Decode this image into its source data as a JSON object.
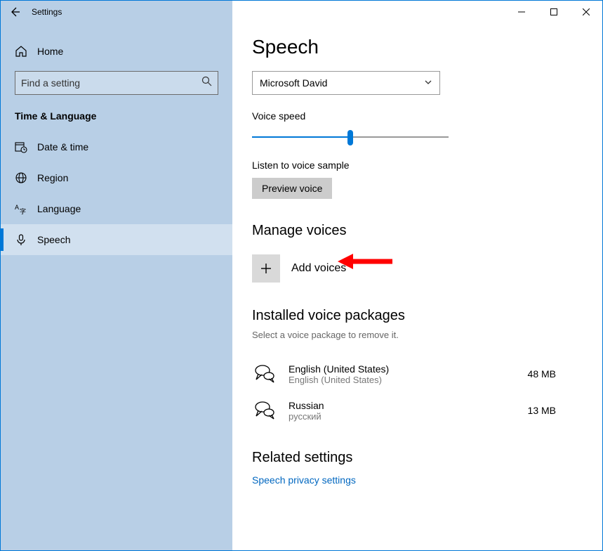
{
  "window": {
    "title": "Settings"
  },
  "sidebar": {
    "home": "Home",
    "search_placeholder": "Find a setting",
    "section": "Time & Language",
    "items": [
      {
        "label": "Date & time"
      },
      {
        "label": "Region"
      },
      {
        "label": "Language"
      },
      {
        "label": "Speech"
      }
    ]
  },
  "page": {
    "title": "Speech",
    "voice_select": "Microsoft David",
    "speed_label": "Voice speed",
    "listen_label": "Listen to voice sample",
    "preview_btn": "Preview voice",
    "manage_header": "Manage voices",
    "add_voices": "Add voices",
    "installed_header": "Installed voice packages",
    "installed_sub": "Select a voice package to remove it.",
    "packages": [
      {
        "name": "English (United States)",
        "sub": "English (United States)",
        "size": "48 MB"
      },
      {
        "name": "Russian",
        "sub": "русский",
        "size": "13 MB"
      }
    ],
    "related_header": "Related settings",
    "privacy_link": "Speech privacy settings"
  }
}
